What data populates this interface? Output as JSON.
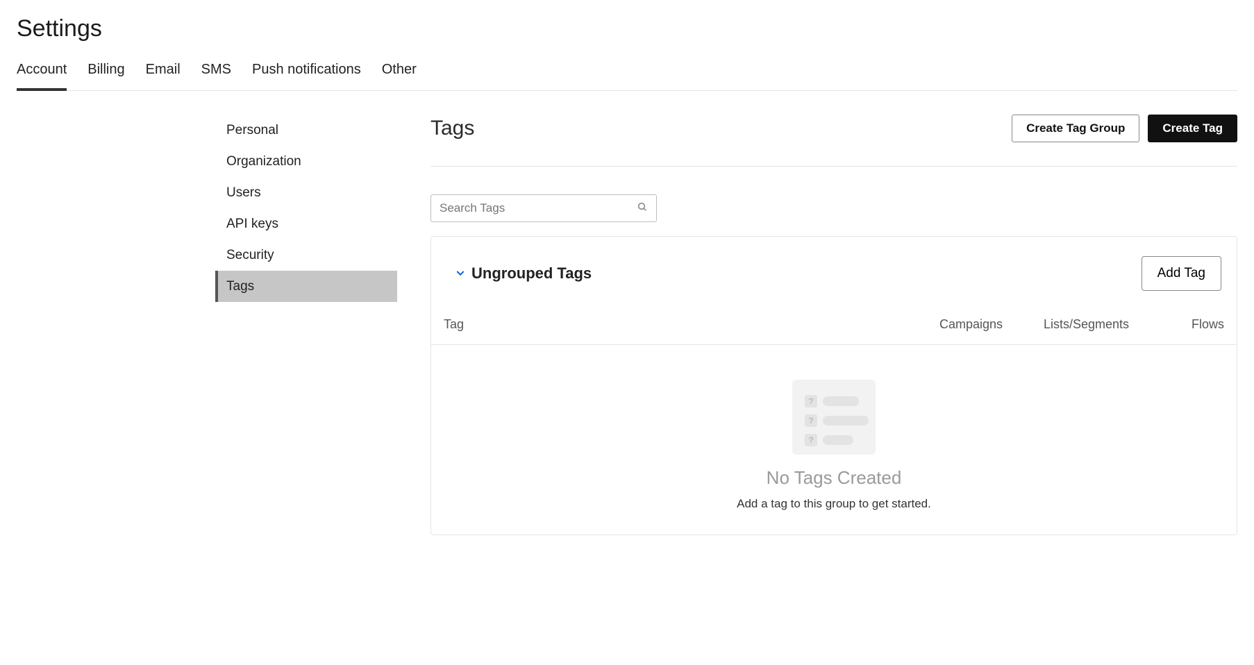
{
  "page": {
    "title": "Settings"
  },
  "tabs": [
    {
      "label": "Account",
      "active": true
    },
    {
      "label": "Billing"
    },
    {
      "label": "Email"
    },
    {
      "label": "SMS"
    },
    {
      "label": "Push notifications"
    },
    {
      "label": "Other"
    }
  ],
  "sidebar": {
    "items": [
      {
        "label": "Personal"
      },
      {
        "label": "Organization"
      },
      {
        "label": "Users"
      },
      {
        "label": "API keys"
      },
      {
        "label": "Security"
      },
      {
        "label": "Tags",
        "active": true
      }
    ]
  },
  "main": {
    "title": "Tags",
    "buttons": {
      "create_group": "Create Tag Group",
      "create_tag": "Create Tag"
    },
    "search": {
      "placeholder": "Search Tags"
    },
    "group": {
      "title": "Ungrouped Tags",
      "add_button": "Add Tag",
      "columns": {
        "tag": "Tag",
        "campaigns": "Campaigns",
        "lists": "Lists/Segments",
        "flows": "Flows"
      },
      "empty": {
        "title": "No Tags Created",
        "subtitle": "Add a tag to this group to get started."
      }
    }
  }
}
